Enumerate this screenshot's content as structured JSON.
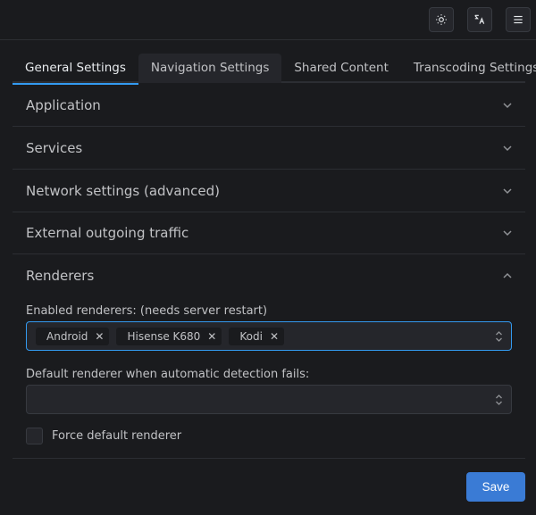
{
  "header": {
    "buttons": [
      {
        "name": "theme-toggle",
        "icon": "sun-icon"
      },
      {
        "name": "language",
        "icon": "translate-icon"
      },
      {
        "name": "menu",
        "icon": "hamburger-icon"
      }
    ]
  },
  "tabs": [
    {
      "label": "General Settings",
      "active": true
    },
    {
      "label": "Navigation Settings",
      "active": false
    },
    {
      "label": "Shared Content",
      "active": false
    },
    {
      "label": "Transcoding Settings",
      "active": false
    }
  ],
  "sections": {
    "application": {
      "title": "Application",
      "expanded": false
    },
    "services": {
      "title": "Services",
      "expanded": false
    },
    "network": {
      "title": "Network settings (advanced)",
      "expanded": false
    },
    "external": {
      "title": "External outgoing traffic",
      "expanded": false
    },
    "renderers": {
      "title": "Renderers",
      "expanded": true
    }
  },
  "renderers": {
    "enabled_label": "Enabled renderers: (needs server restart)",
    "enabled_chips": [
      "Android",
      "Hisense K680",
      "Kodi"
    ],
    "default_label": "Default renderer when automatic detection fails:",
    "default_value": "",
    "force_label": "Force default renderer",
    "force_checked": false
  },
  "actions": {
    "save_label": "Save"
  },
  "colors": {
    "background": "#1a1b1e",
    "accent": "#339af0",
    "save_button": "#3a7bd5"
  }
}
